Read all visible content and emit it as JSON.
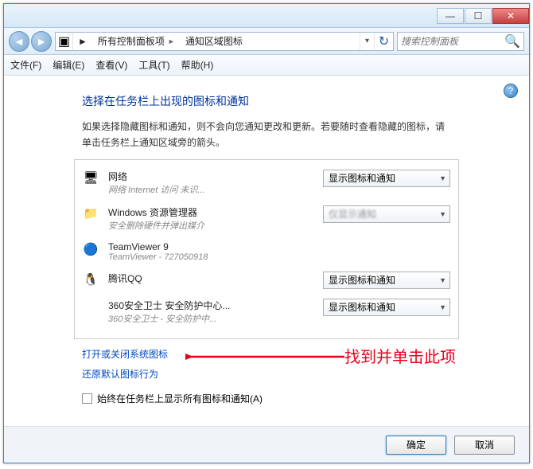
{
  "titlebar": {
    "minimize": "—",
    "maximize": "☐",
    "close": "✕"
  },
  "nav": {
    "back": "◄",
    "forward": "►",
    "breadcrumb1": "所有控制面板项",
    "breadcrumb2": "通知区域图标",
    "refresh": "↻"
  },
  "search": {
    "placeholder": "搜索控制面板"
  },
  "menu": {
    "file": "文件(F)",
    "edit": "编辑(E)",
    "view": "查看(V)",
    "tools": "工具(T)",
    "help": "帮助(H)"
  },
  "page": {
    "title": "选择在任务栏上出现的图标和通知",
    "desc": "如果选择隐藏图标和通知，则不会向您通知更改和更新。若要随时查看隐藏的图标，请单击任务栏上通知区域旁的箭头。"
  },
  "items": [
    {
      "icon": "🖥",
      "name": "网络",
      "sub": "网络 Internet 访问 未识...",
      "option": "显示图标和通知"
    },
    {
      "icon": "📁",
      "name": "Windows 资源管理器",
      "sub": "安全删除硬件并弹出媒介",
      "option": "仅显示通知",
      "blurred": true
    },
    {
      "icon": "🔵",
      "name": "TeamViewer 9",
      "sub": "TeamViewer - 727050918",
      "option": ""
    },
    {
      "icon": "🐧",
      "name": "腾讯QQ",
      "sub": "",
      "option": "显示图标和通知"
    },
    {
      "icon": "",
      "name": "360安全卫士 安全防护中心...",
      "sub": "360安全卫士 - 安全防护中...",
      "option": "显示图标和通知"
    }
  ],
  "links": {
    "systemIcons": "打开或关闭系统图标",
    "restore": "还原默认图标行为",
    "annotation": "找到并单击此项"
  },
  "checkbox": {
    "label": "始终在任务栏上显示所有图标和通知(A)"
  },
  "footer": {
    "ok": "确定",
    "cancel": "取消"
  }
}
